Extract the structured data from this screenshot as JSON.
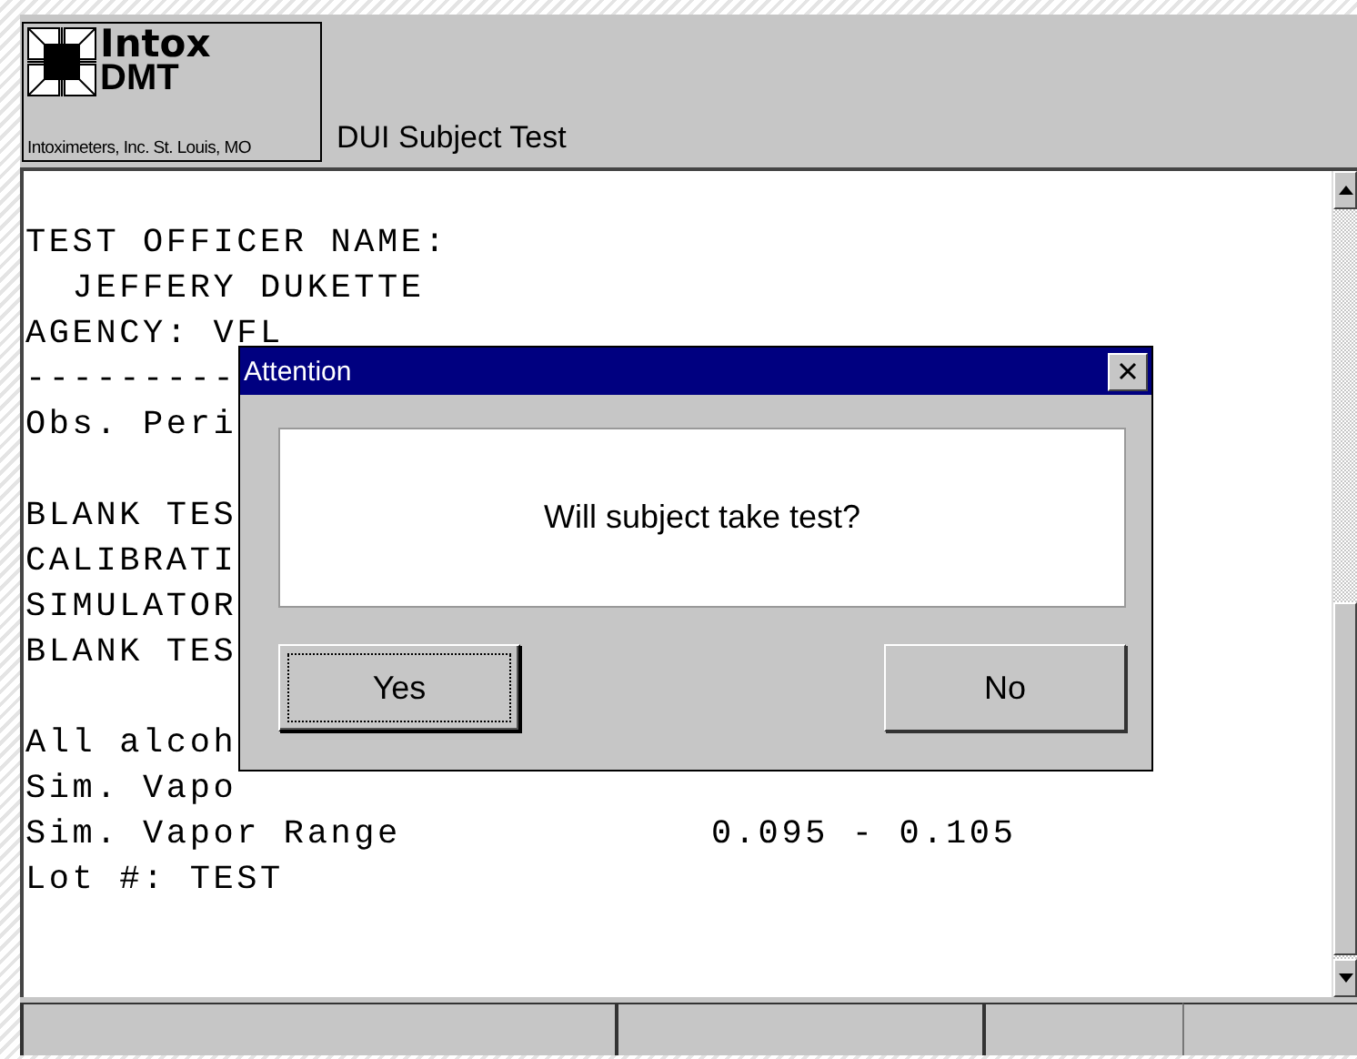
{
  "header": {
    "logo": {
      "name": "Intox",
      "product": "DMT",
      "company": "Intoximeters, Inc. St. Louis, MO"
    },
    "title": "DUI Subject Test"
  },
  "report": {
    "blocks": [
      {
        "lines": [
          {
            "text": "TEST OFFICER NAME:"
          },
          {
            "text": "  JEFFERY DUKETTE"
          },
          {
            "text": "AGENCY: VFL"
          },
          {
            "text": "---------"
          },
          {
            "text": "Obs. Peri"
          }
        ]
      },
      {
        "lines": [
          {
            "text": "BLANK TES"
          },
          {
            "text": "CALIBRATI"
          },
          {
            "text": "SIMULATOR"
          },
          {
            "text": "BLANK TES"
          }
        ]
      },
      {
        "lines": [
          {
            "text": "All alcoh"
          },
          {
            "text": "Sim. Vapo"
          },
          {
            "text": "Sim. Vapor Range",
            "value": "0.095 - 0.105"
          },
          {
            "text": "Lot #: TEST"
          }
        ]
      }
    ]
  },
  "dialog": {
    "title": "Attention",
    "message": "Will subject take test?",
    "buttons": [
      {
        "label": "Yes",
        "focused": true
      },
      {
        "label": "No",
        "focused": false
      }
    ]
  }
}
